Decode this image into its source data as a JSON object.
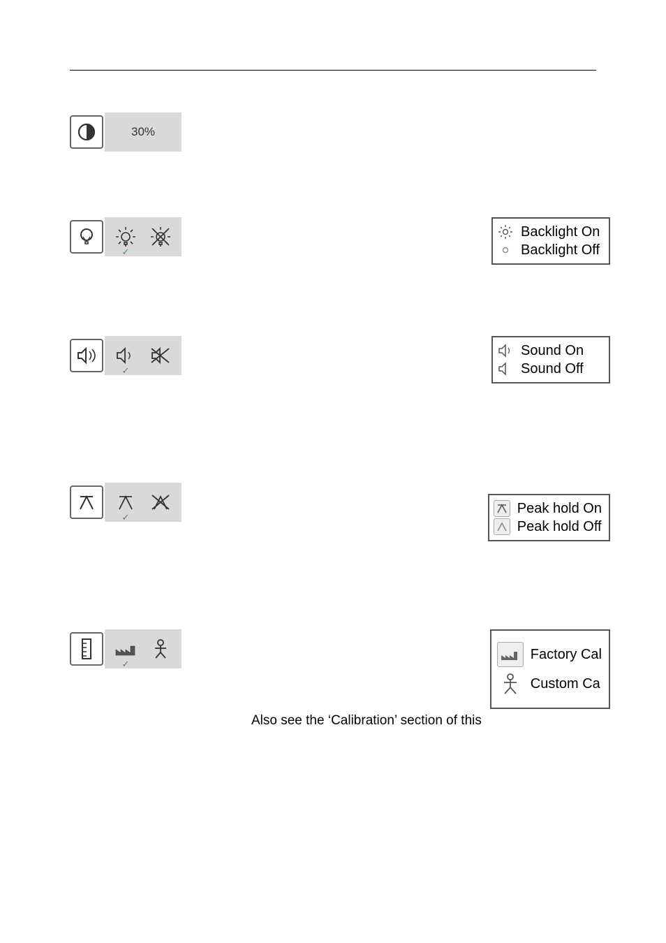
{
  "contrast": {
    "value_label": "30%"
  },
  "backlight": {
    "legend_on": "Backlight On",
    "legend_off": "Backlight Off"
  },
  "sound": {
    "legend_on": "Sound On",
    "legend_off": "Sound Off"
  },
  "peak_hold": {
    "legend_on": "Peak hold On",
    "legend_off": "Peak hold Off"
  },
  "calibration": {
    "legend_factory": "Factory Cal",
    "legend_custom": "Custom Ca"
  },
  "note": "Also see the ‘Calibration’ section of this"
}
